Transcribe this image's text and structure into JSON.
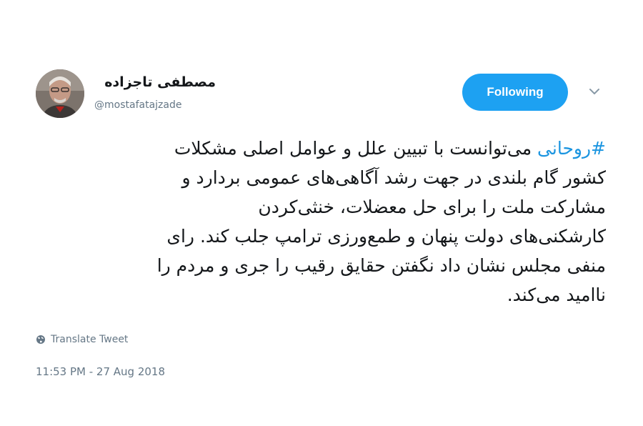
{
  "profile": {
    "display_name": "مصطفی تاجزاده",
    "handle": "@mostafatajzade"
  },
  "follow_button": {
    "label": "Following"
  },
  "tweet": {
    "hashtag": "#روحانی",
    "line1_rest": " می‌توانست با تبیین علل و عوامل اصلی مشکلات",
    "body": "کشور گام بلندی در جهت رشد آگاهی‌های عمومی بردارد و\nمشارکت ملت را برای حل معضلات، خنثی‌کردن\nکارشکنی‌های دولت پنهان و طمع‌ورزی ترامپ جلب کند. رای\nمنفی مجلس نشان داد نگفتن حقایق رقیب را جری و مردم را\nناامید می‌کند."
  },
  "translate_link": {
    "label": "Translate Tweet"
  },
  "timestamp": "11:53 PM - 27 Aug 2018",
  "colors": {
    "accent": "#1da1f2",
    "hashtag": "#1b95e0",
    "secondary_text": "#657786"
  },
  "icons": {
    "translate": "globe-icon",
    "caret": "chevron-down-icon"
  }
}
